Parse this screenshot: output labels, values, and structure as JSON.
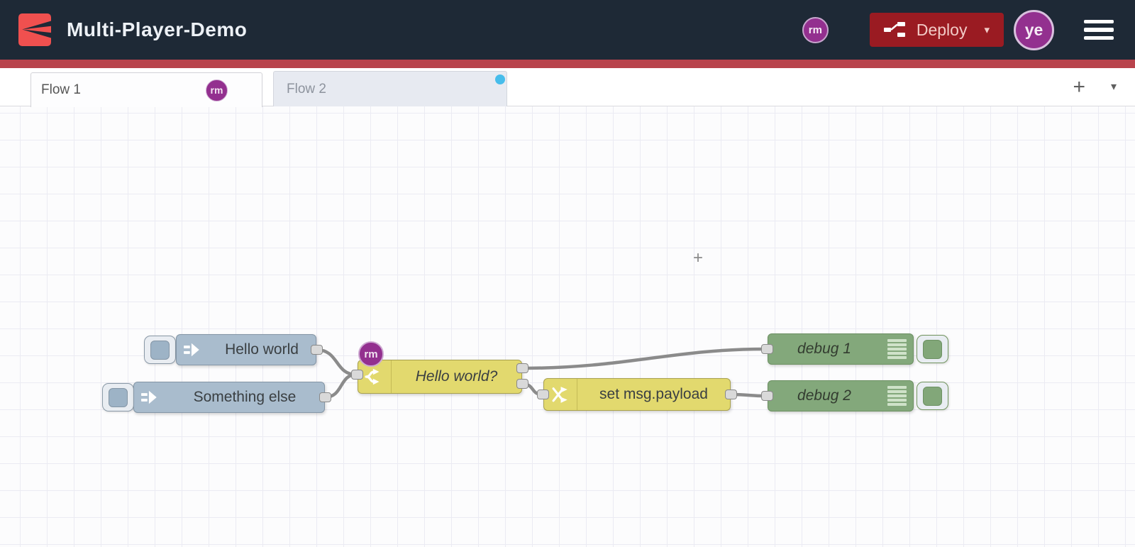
{
  "header": {
    "title": "Multi-Player-Demo",
    "deploy": {
      "label": "Deploy",
      "caret": "▾"
    },
    "collaborator_avatar": "rm",
    "user_avatar": "ye"
  },
  "tabs": {
    "flow1": {
      "label": "Flow 1",
      "badge": "rm",
      "active": true
    },
    "flow2": {
      "label": "Flow 2",
      "has_unread_dot": true
    },
    "add_button": "+",
    "list_caret": "▾"
  },
  "flow": {
    "nodes": {
      "inject1": {
        "type": "inject",
        "label": "Hello world"
      },
      "inject2": {
        "type": "inject",
        "label": "Something else"
      },
      "switch1": {
        "type": "switch",
        "label": "Hello world?",
        "badge": "rm",
        "outputs": 2
      },
      "change1": {
        "type": "change",
        "label": "set msg.payload"
      },
      "debug1": {
        "type": "debug",
        "label": "debug 1"
      },
      "debug2": {
        "type": "debug",
        "label": "debug 2"
      }
    },
    "wires": [
      {
        "from": "inject1",
        "to": "switch1"
      },
      {
        "from": "inject2",
        "to": "switch1"
      },
      {
        "from": "switch1:output1",
        "to": "debug1"
      },
      {
        "from": "switch1:output2",
        "to": "change1"
      },
      {
        "from": "change1",
        "to": "debug2"
      }
    ],
    "cursor": "+"
  },
  "colors": {
    "header_bg": "#1e2936",
    "accent_red_line": "#b8434c",
    "deploy_red": "#9a1b22",
    "logo_red": "#f0504f",
    "avatar_purple": "#93308f",
    "inject_fill": "#a9bccd",
    "function_yellow": "#e2d96e",
    "debug_green": "#83a87b",
    "wire_gray": "#8b8b8b",
    "unread_blue": "#47bdeb",
    "port_gray": "#d9d9d9"
  }
}
